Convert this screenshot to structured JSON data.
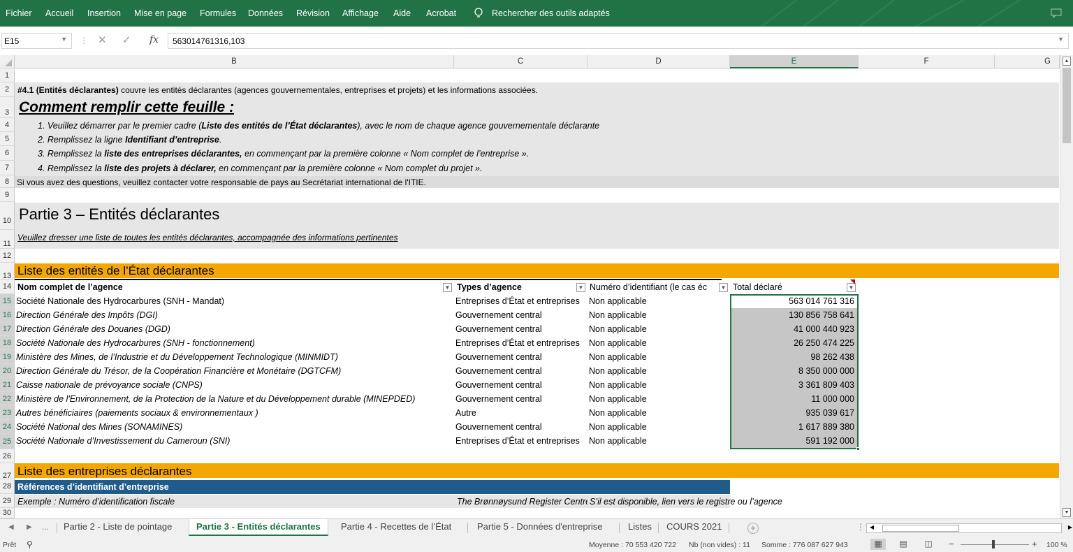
{
  "ribbon": {
    "menu": [
      "Fichier",
      "Accueil",
      "Insertion",
      "Mise en page",
      "Formules",
      "Données",
      "Révision",
      "Affichage",
      "Aide",
      "Acrobat"
    ],
    "search_label": "Rechercher des outils adaptés"
  },
  "formula_bar": {
    "cell_ref": "E15",
    "fx": "fx",
    "formula": "563014761316,103"
  },
  "columns": [
    {
      "label": "B",
      "selected": false
    },
    {
      "label": "C",
      "selected": false
    },
    {
      "label": "D",
      "selected": false
    },
    {
      "label": "E",
      "selected": true
    },
    {
      "label": "F",
      "selected": false
    },
    {
      "label": "G",
      "selected": false
    }
  ],
  "row_numbers": [
    "1",
    "2",
    "3",
    "4",
    "5",
    "6",
    "7",
    "8",
    "9",
    "10",
    "11",
    "12",
    "13",
    "14",
    "15",
    "16",
    "17",
    "18",
    "19",
    "20",
    "21",
    "22",
    "23",
    "24",
    "25",
    "26",
    "27",
    "28",
    "29",
    "30"
  ],
  "intro": {
    "row2_bold": "#4.1 (Entités déclarantes)",
    "row2_rest": " couvre les entités déclarantes (agences gouvernementales, entreprises et projets) et les informations associées.",
    "how_title": "Comment remplir cette feuille :",
    "steps": [
      {
        "pre": "1. Veuillez démarrer par le premier cadre (",
        "bold": "Liste des entités de l’État déclarantes",
        "post": "), avec le nom de chaque agence gouvernementale déclarante"
      },
      {
        "pre": "2. Remplissez la ligne ",
        "bold": "Identifiant d’entreprise",
        "post": "."
      },
      {
        "pre": "3. Remplissez la ",
        "bold": "liste des entreprises déclarantes,",
        "post": " en commençant par la première colonne « Nom complet de l’entreprise »."
      },
      {
        "pre": "4. Remplissez la ",
        "bold": "liste des projets à déclarer,",
        "post": " en commençant par la première colonne « Nom complet du projet »."
      }
    ],
    "contact": "Si vous avez des questions, veuillez contacter votre responsable de pays au Secrétariat international de l'ITIE.",
    "part_title": "Partie 3 – Entités déclarantes",
    "part_sub": "Veuillez dresser une liste de toutes les entités déclarantes, accompagnée des informations pertinentes"
  },
  "state_table": {
    "title": "Liste des entités de l’État déclarantes",
    "headers": [
      "Nom complet de l’agence",
      "Types d’agence",
      "Numéro d’identifiant (le cas éc",
      "Total déclaré"
    ],
    "rows": [
      {
        "name": "Société Nationale des Hydrocarbures (SNH - Mandat)",
        "type": "Entreprises d’État et entreprises",
        "id": "Non applicable",
        "total": "563 014 761 316",
        "italic": false
      },
      {
        "name": "Direction Générale des Impôts (DGI)",
        "type": "Gouvernement central",
        "id": "Non applicable",
        "total": "130 856 758 641",
        "italic": true
      },
      {
        "name": "Direction Générale des Douanes (DGD)",
        "type": "Gouvernement central",
        "id": "Non applicable",
        "total": "41 000 440 923",
        "italic": true
      },
      {
        "name": "Société Nationale des Hydrocarbures (SNH - fonctionnement)",
        "type": "Entreprises d’État et entreprises",
        "id": "Non applicable",
        "total": "26 250 474 225",
        "italic": true
      },
      {
        "name": "Ministère des Mines, de l’Industrie et du Développement Technologique (MINMIDT)",
        "type": "Gouvernement central",
        "id": "Non applicable",
        "total": "98 262 438",
        "italic": true
      },
      {
        "name": "Direction Générale du Trésor, de la Coopération Financière et Monétaire (DGTCFM)",
        "type": "Gouvernement central",
        "id": "Non applicable",
        "total": "8 350 000 000",
        "italic": true
      },
      {
        "name": "Caisse nationale de prévoyance sociale (CNPS)",
        "type": "Gouvernement central",
        "id": "Non applicable",
        "total": "3 361 809 403",
        "italic": true
      },
      {
        "name": "Ministère de l'Environnement, de la Protection de la Nature et du Développement durable (MINEPDED)",
        "type": "Gouvernement central",
        "id": "Non applicable",
        "total": "11 000 000",
        "italic": true
      },
      {
        "name": "Autres bénéficiaires (paiements sociaux & environnementaux )",
        "type": "Autre",
        "id": "Non applicable",
        "total": "935 039 617",
        "italic": true
      },
      {
        "name": "Société National des Mines (SONAMINES)",
        "type": "Gouvernement central",
        "id": "Non applicable",
        "total": "1 617 889 380",
        "italic": true
      },
      {
        "name": "Société Nationale d’Investissement du Cameroun (SNI)",
        "type": "Entreprises d’État et entreprises",
        "id": "Non applicable",
        "total": "591 192 000",
        "italic": true
      }
    ]
  },
  "companies": {
    "title": "Liste des entreprises déclarantes",
    "ref_header": "Références d’identifiant d’entreprise",
    "example_b": "Exemple : Numéro d’identification fiscale",
    "example_c": "The Brønnøysund Register Centre",
    "example_d": "S’il est disponible, lien vers le registre ou l’agence"
  },
  "tabs": {
    "ellipsis": "...",
    "items": [
      {
        "label": "Partie 2 - Liste de pointage",
        "active": false
      },
      {
        "label": "Partie 3 - Entités déclarantes",
        "active": true
      },
      {
        "label": "Partie 4 - Recettes de l’État",
        "active": false
      },
      {
        "label": "Partie 5 - Données d'entreprise",
        "active": false
      },
      {
        "label": "Listes",
        "active": false
      },
      {
        "label": "COURS 2021",
        "active": false
      }
    ]
  },
  "status": {
    "ready": "Prêt",
    "average": "Moyenne : 70 553 420 722",
    "count": "Nb (non vides) : 11",
    "sum": "Somme : 776 087 627 943",
    "zoom": "100 %"
  },
  "colors": {
    "ribbon": "#217346",
    "orange": "#f4a700",
    "blue_header": "#1f5c8b",
    "gray_band": "#e6e6e6",
    "selection": "#c6c6c6"
  }
}
